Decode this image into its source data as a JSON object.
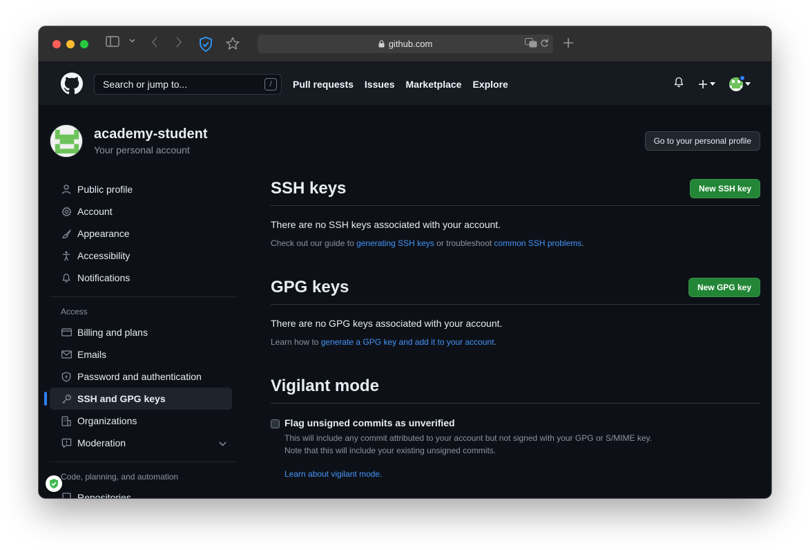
{
  "browser": {
    "url": "github.com"
  },
  "header": {
    "search_placeholder": "Search or jump to...",
    "search_shortcut": "/",
    "nav": [
      "Pull requests",
      "Issues",
      "Marketplace",
      "Explore"
    ],
    "plus": "+"
  },
  "profile": {
    "username": "academy-student",
    "subtitle": "Your personal account",
    "go_profile_label": "Go to your personal profile"
  },
  "sidebar": {
    "items": [
      {
        "label": "Public profile",
        "icon": "person-icon"
      },
      {
        "label": "Account",
        "icon": "gear-icon"
      },
      {
        "label": "Appearance",
        "icon": "paintbrush-icon"
      },
      {
        "label": "Accessibility",
        "icon": "accessibility-icon"
      },
      {
        "label": "Notifications",
        "icon": "bell-icon"
      }
    ],
    "access_heading": "Access",
    "access_items": [
      {
        "label": "Billing and plans",
        "icon": "credit-card-icon"
      },
      {
        "label": "Emails",
        "icon": "mail-icon"
      },
      {
        "label": "Password and authentication",
        "icon": "shield-lock-icon"
      },
      {
        "label": "SSH and GPG keys",
        "icon": "key-icon",
        "active": true
      },
      {
        "label": "Organizations",
        "icon": "organization-icon"
      },
      {
        "label": "Moderation",
        "icon": "report-icon"
      }
    ],
    "code_heading": "Code, planning, and automation",
    "code_items": [
      {
        "label": "Repositories",
        "icon": "repo-icon"
      }
    ]
  },
  "ssh": {
    "title": "SSH keys",
    "button": "New SSH key",
    "empty": "There are no SSH keys associated with your account.",
    "guide_prefix": "Check out our guide to ",
    "guide_link": "generating SSH keys",
    "guide_mid": " or troubleshoot ",
    "guide_link2": "common SSH problems",
    "guide_suffix": "."
  },
  "gpg": {
    "title": "GPG keys",
    "button": "New GPG key",
    "empty": "There are no GPG keys associated with your account.",
    "learn_prefix": "Learn how to ",
    "learn_link": "generate a GPG key and add it to your account",
    "learn_suffix": "."
  },
  "vigilant": {
    "title": "Vigilant mode",
    "checkbox_label": "Flag unsigned commits as unverified",
    "checked": false,
    "note1": "This will include any commit attributed to your account but not signed with your GPG or S/MIME key.",
    "note2": "Note that this will include your existing unsigned commits.",
    "link": "Learn about vigilant mode."
  },
  "colors": {
    "bg": "#0d1117",
    "header_bg": "#161b22",
    "accent_blue": "#2f81f7",
    "link": "#4493f8",
    "green_button": "#238636"
  }
}
